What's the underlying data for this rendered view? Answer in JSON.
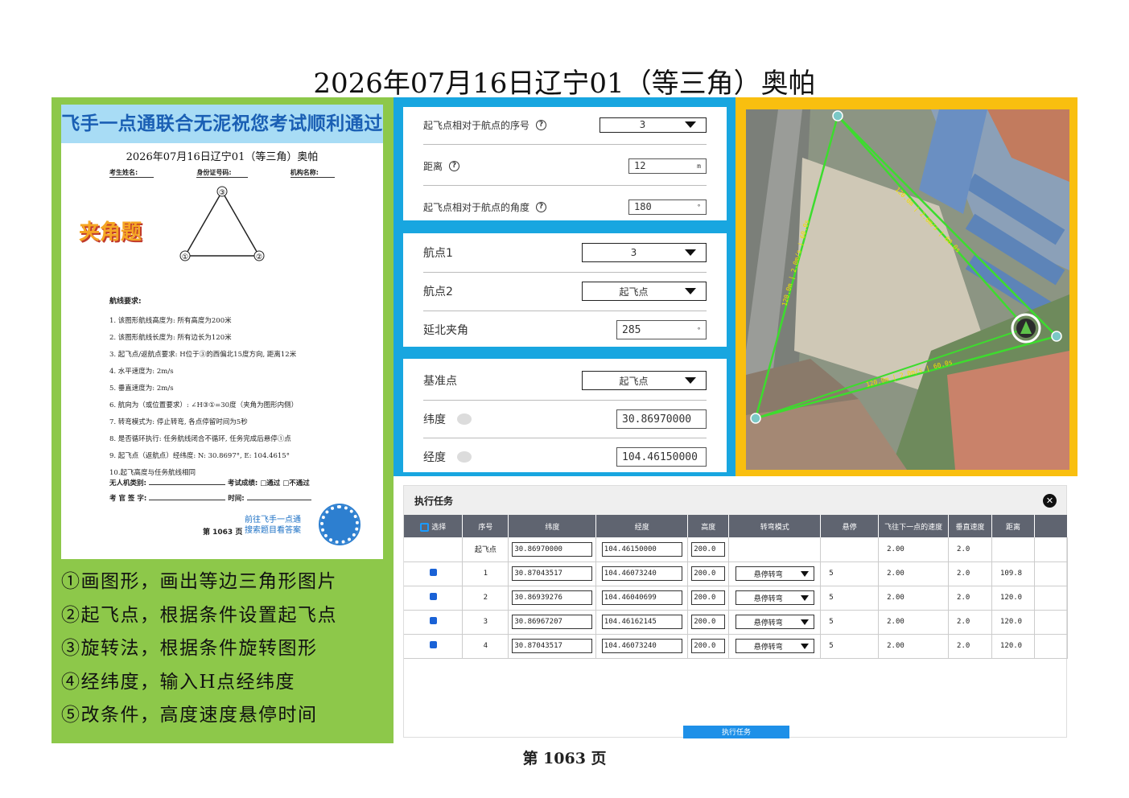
{
  "title": "2026年07月16日辽宁01（等三角）奥帕",
  "doc": {
    "banner": "飞手一点通联合无泥祝您考试顺利通过",
    "subtitle": "2026年07月16日辽宁01（等三角）奥帕",
    "field_name": "考生姓名:",
    "field_id": "身份证号码:",
    "field_org": "机构名称:",
    "stamp": "夹角题",
    "tri_labels": [
      "③",
      "①",
      "②"
    ],
    "req_head": "航线要求:",
    "requirements": [
      "1. 该图形航线高度为: 所有高度为200米",
      "2. 该图形航线长度为: 所有边长为120米",
      "3. 起飞点/返航点要求: H位于③的西偏北15度方向, 距离12米",
      "4. 水平速度为: 2m/s",
      "5. 垂直速度为: 2m/s",
      "6. 航向为（或位置要求）: ∠H③①=30度（夹角为图形内侧）",
      "7. 转弯模式为: 停止转弯, 各点停留时间为5秒",
      "8. 是否循环执行: 任务航线闭合不循环, 任务完成后悬停①点",
      "9. 起飞点（返航点）经纬度: N: 30.8697°, E: 104.4615°",
      "10.起飞高度与任务航线相同"
    ],
    "foot_type": "无人机类别:",
    "foot_result": "考试成绩: □通过 □不通过",
    "foot_sign": "考 官 签 字:",
    "foot_time": "时间:",
    "promo_1": "前往飞手一点通",
    "promo_2": "搜索题目看答案",
    "page_small": "第 1063 页"
  },
  "steps": [
    "①画图形，画出等边三角形图片",
    "②起飞点，根据条件设置起飞点",
    "③旋转法，根据条件旋转图形",
    "④经纬度，输入H点经纬度",
    "⑤改条件，高度速度悬停时间"
  ],
  "form1": {
    "seq_label": "起飞点相对于航点的序号",
    "seq_value": "3",
    "dist_label": "距离",
    "dist_value": "12",
    "dist_unit": "m",
    "angle_label": "起飞点相对于航点的角度",
    "angle_value": "180",
    "angle_unit": "°"
  },
  "form2": {
    "wp1_label": "航点1",
    "wp1_value": "3",
    "wp2_label": "航点2",
    "wp2_value": "起飞点",
    "north_label": "延北夹角",
    "north_value": "285",
    "north_unit": "°"
  },
  "form3": {
    "base_label": "基准点",
    "base_value": "起飞点",
    "lat_label": "纬度",
    "lat_value": "30.86970000",
    "lon_label": "经度",
    "lon_value": "104.46150000"
  },
  "map": {
    "leg_label": "120.0m | 2.0m/s | 60.0s"
  },
  "task": {
    "title": "执行任务",
    "close": "✕",
    "headers": [
      "选择",
      "序号",
      "纬度",
      "经度",
      "高度",
      "转弯模式",
      "悬停",
      "飞往下一点的速度",
      "垂直速度",
      "距离"
    ],
    "rows": [
      {
        "seq": "起飞点",
        "lat": "30.86970000",
        "lon": "104.46150000",
        "alt": "200.0",
        "turn": "",
        "hover": "",
        "speed": "2.00",
        "vspeed": "2.0",
        "dist": ""
      },
      {
        "seq": "1",
        "lat": "30.87043517",
        "lon": "104.46073240",
        "alt": "200.0",
        "turn": "悬停转弯",
        "hover": "5",
        "speed": "2.00",
        "vspeed": "2.0",
        "dist": "109.8"
      },
      {
        "seq": "2",
        "lat": "30.86939276",
        "lon": "104.46040699",
        "alt": "200.0",
        "turn": "悬停转弯",
        "hover": "5",
        "speed": "2.00",
        "vspeed": "2.0",
        "dist": "120.0"
      },
      {
        "seq": "3",
        "lat": "30.86967207",
        "lon": "104.46162145",
        "alt": "200.0",
        "turn": "悬停转弯",
        "hover": "5",
        "speed": "2.00",
        "vspeed": "2.0",
        "dist": "120.0"
      },
      {
        "seq": "4",
        "lat": "30.87043517",
        "lon": "104.46073240",
        "alt": "200.0",
        "turn": "悬停转弯",
        "hover": "5",
        "speed": "2.00",
        "vspeed": "2.0",
        "dist": "120.0"
      }
    ],
    "exec_button": "执行任务"
  },
  "footer": "第 1063 页"
}
